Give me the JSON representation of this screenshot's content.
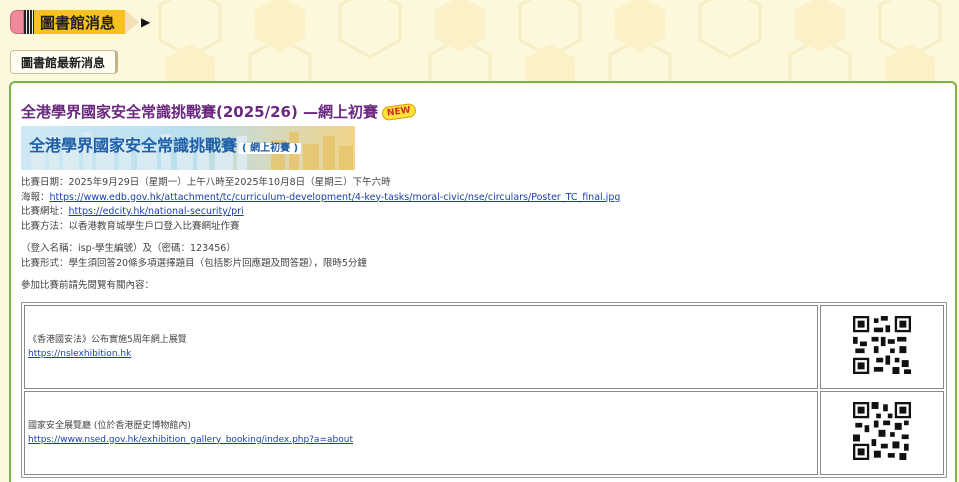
{
  "header": {
    "title": "圖書館消息"
  },
  "subtab": {
    "label": "圖書館最新消息"
  },
  "article": {
    "title": "全港學界國家安全常識挑戰賽(2025/26) —網上初賽",
    "badge": "NEW",
    "banner_title": "全港學界國家安全常識挑戰賽",
    "banner_subtitle": "( 網上初賽 )",
    "date_line": "比賽日期：2025年9月29日（星期一）上午八時至2025年10月8日（星期三）下午六時",
    "poster_label": "海報：",
    "poster_url": "https://www.edb.gov.hk/attachment/tc/curriculum-development/4-key-tasks/moral-civic/nse/circulars/Poster_TC_final.jpg",
    "site_label": "比賽網址：",
    "site_url": "https://edcity.hk/national-security/pri",
    "method_line": "比賽方法：以香港教育城學生戶口登入比賽網址作賽",
    "login_line": "（登入名稱：isp-學生編號）及（密碼：123456）",
    "format_line": "比賽形式：學生須回答20條多項選擇題目（包括影片回應題及問答題），限時5分鐘",
    "browse_line": "參加比賽前請先閱覽有關內容："
  },
  "resources": [
    {
      "title": "《香港國安法》公布實施5周年網上展覽",
      "url": "https://nslexhibition.hk"
    },
    {
      "title": "國家安全展覽廳 (位於香港歷史博物館內)",
      "url": "https://www.nsed.gov.hk/exhibition_gallery_booking/index.php?a=about"
    }
  ],
  "colors": {
    "accent": "#6b2a7f",
    "border": "#7bb347",
    "link": "#1a3faa",
    "header_bg": "#f8c11d"
  }
}
